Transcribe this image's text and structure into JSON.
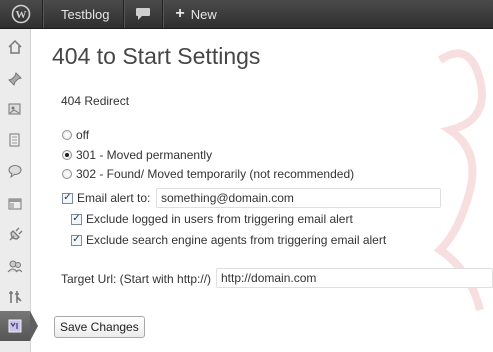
{
  "adminbar": {
    "site_name": "Testblog",
    "new_label": "New"
  },
  "page": {
    "title": "404 to Start Settings",
    "section_label": "404 Redirect"
  },
  "redirect_options": [
    {
      "label": "off",
      "checked": false
    },
    {
      "label": "301 - Moved permanently",
      "checked": true
    },
    {
      "label": "302 - Found/ Moved temporarily (not recommended)",
      "checked": false
    }
  ],
  "email_alert": {
    "label": "Email alert to:",
    "checked": true,
    "value": "something@domain.com"
  },
  "exclusions": [
    {
      "label": "Exclude logged in users from triggering email alert",
      "checked": true
    },
    {
      "label": "Exclude search engine agents from triggering email alert",
      "checked": true
    }
  ],
  "target_url": {
    "label": "Target Url: (Start with http://)",
    "value": "http://domain.com"
  },
  "save_button": "Save Changes",
  "sidebar_icons": [
    "dashboard-icon",
    "pin-icon",
    "media-icon",
    "pages-icon",
    "comments-icon",
    "appearance-icon",
    "plugins-icon",
    "users-icon",
    "tools-icon",
    "settings-icon"
  ],
  "colors": {
    "adminbar": "#333333",
    "sidebar": "#ececec",
    "active_menu": "#5f5f5f"
  }
}
